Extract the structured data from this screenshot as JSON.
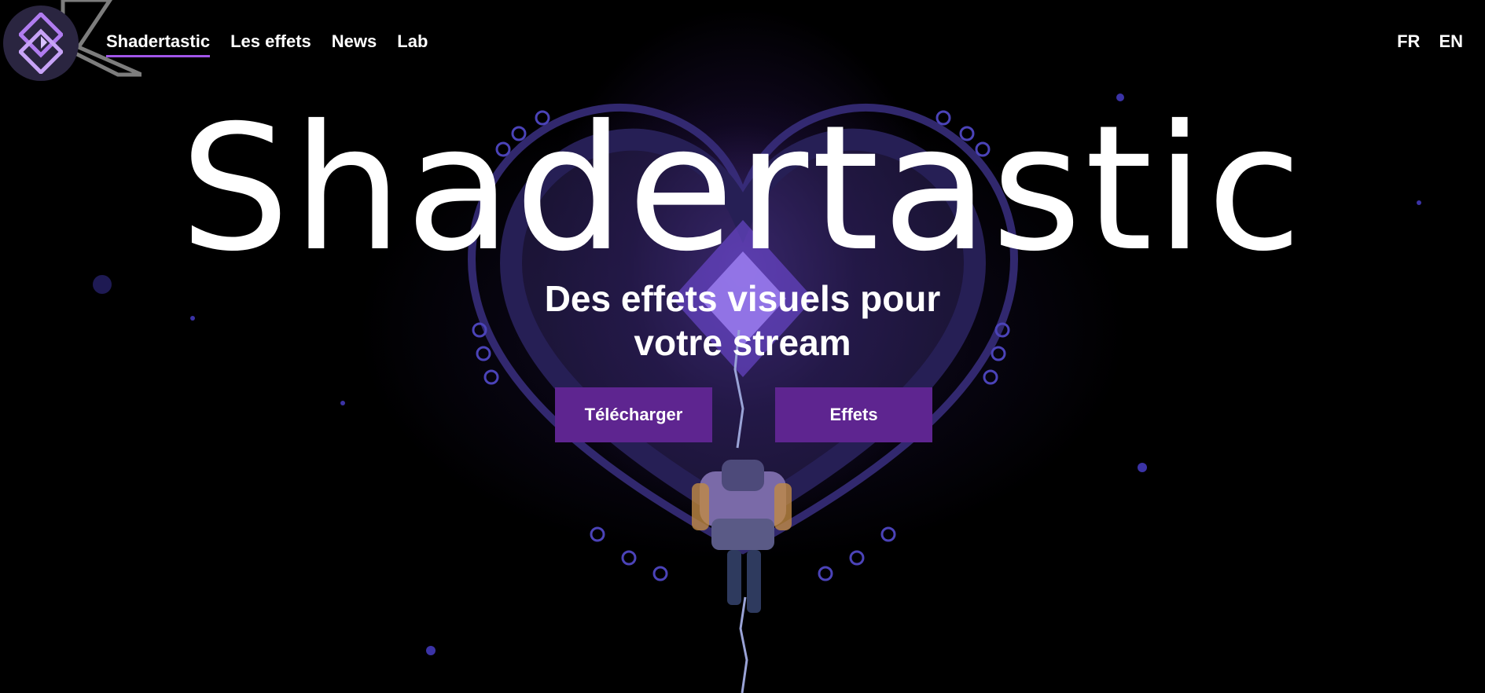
{
  "nav": {
    "items": [
      {
        "label": "Shadertastic",
        "active": true
      },
      {
        "label": "Les effets",
        "active": false
      },
      {
        "label": "News",
        "active": false
      },
      {
        "label": "Lab",
        "active": false
      }
    ],
    "languages": [
      "FR",
      "EN"
    ]
  },
  "hero": {
    "title": "Shadertastic",
    "subtitle_line1": "Des effets visuels pour",
    "subtitle_line2": "votre stream",
    "download_label": "Télécharger",
    "effects_label": "Effets"
  },
  "colors": {
    "accent": "#a155e8",
    "button": "#5e2590",
    "background": "#000000"
  },
  "icons": {
    "logo": "shadertastic-logo-icon"
  }
}
